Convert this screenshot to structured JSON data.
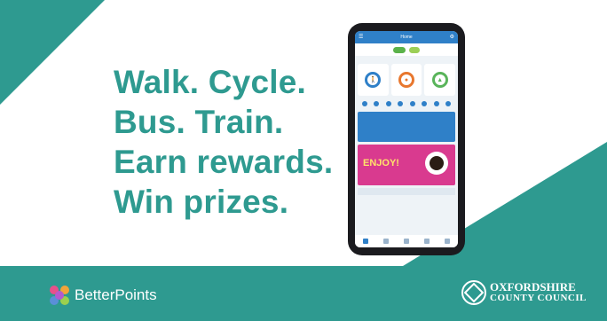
{
  "headline": [
    "Walk. Cycle.",
    "Bus. Train.",
    "Earn rewards.",
    "Win prizes."
  ],
  "brand": {
    "name": "BetterPoints",
    "accent": "#2e9a90"
  },
  "council": {
    "line1": "OXFORDSHIRE",
    "line2": "COUNTY COUNCIL"
  },
  "phone_app": {
    "title": "Home",
    "promo_text": "ENJOY!"
  },
  "icons": [
    "menu-icon",
    "gear-icon",
    "walk-icon",
    "cycle-icon",
    "leaf-icon",
    "coffee-icon"
  ]
}
